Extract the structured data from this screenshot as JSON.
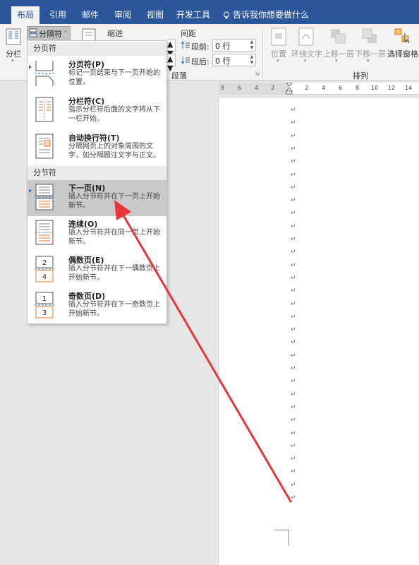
{
  "tabs": [
    {
      "label": "布局",
      "active": true
    },
    {
      "label": "引用"
    },
    {
      "label": "邮件"
    },
    {
      "label": "审阅"
    },
    {
      "label": "视图"
    },
    {
      "label": "开发工具"
    }
  ],
  "tell_me": "告诉我你想要做什么",
  "ribbon": {
    "columns_label": "分栏",
    "breaks_label": "分隔符",
    "indent_label": "缩进",
    "spacing_label": "间距",
    "before_label": "段前:",
    "before_value": "0 行",
    "after_label": "段后:",
    "after_value": "0 行",
    "paragraph_group": "段落",
    "position_label": "位置",
    "wrap_label": "环绕文字",
    "forward_label": "上移一层",
    "backward_label": "下移一层",
    "selection_pane_label": "选择窗格",
    "arrange_group": "排列"
  },
  "menu": {
    "page_breaks_header": "分页符",
    "section_breaks_header": "分节符",
    "items": [
      {
        "title": "分页符(P)",
        "desc": "标记一页结束与下一页开始的位置。"
      },
      {
        "title": "分栏符(C)",
        "desc": "指示分栏符后面的文字将从下一栏开始。"
      },
      {
        "title": "自动换行符(T)",
        "desc": "分隔网页上的对象周围的文字，如分隔题注文字与正文。"
      },
      {
        "title": "下一页(N)",
        "desc": "插入分节符并在下一页上开始新节。"
      },
      {
        "title": "连续(O)",
        "desc": "插入分节符并在同一页上开始新节。"
      },
      {
        "title": "偶数页(E)",
        "desc": "插入分节符并在下一偶数页上开始新节。"
      },
      {
        "title": "奇数页(D)",
        "desc": "插入分节符并在下一奇数页上开始新节。"
      }
    ]
  },
  "ruler_ticks": [
    "8",
    "6",
    "4",
    "2",
    "2",
    "4",
    "6",
    "8",
    "10",
    "12",
    "14"
  ],
  "paragraph_mark": "↵",
  "colors": {
    "accent": "#2b579a",
    "arrow": "#e8353b",
    "hover": "#c9c9c9"
  }
}
